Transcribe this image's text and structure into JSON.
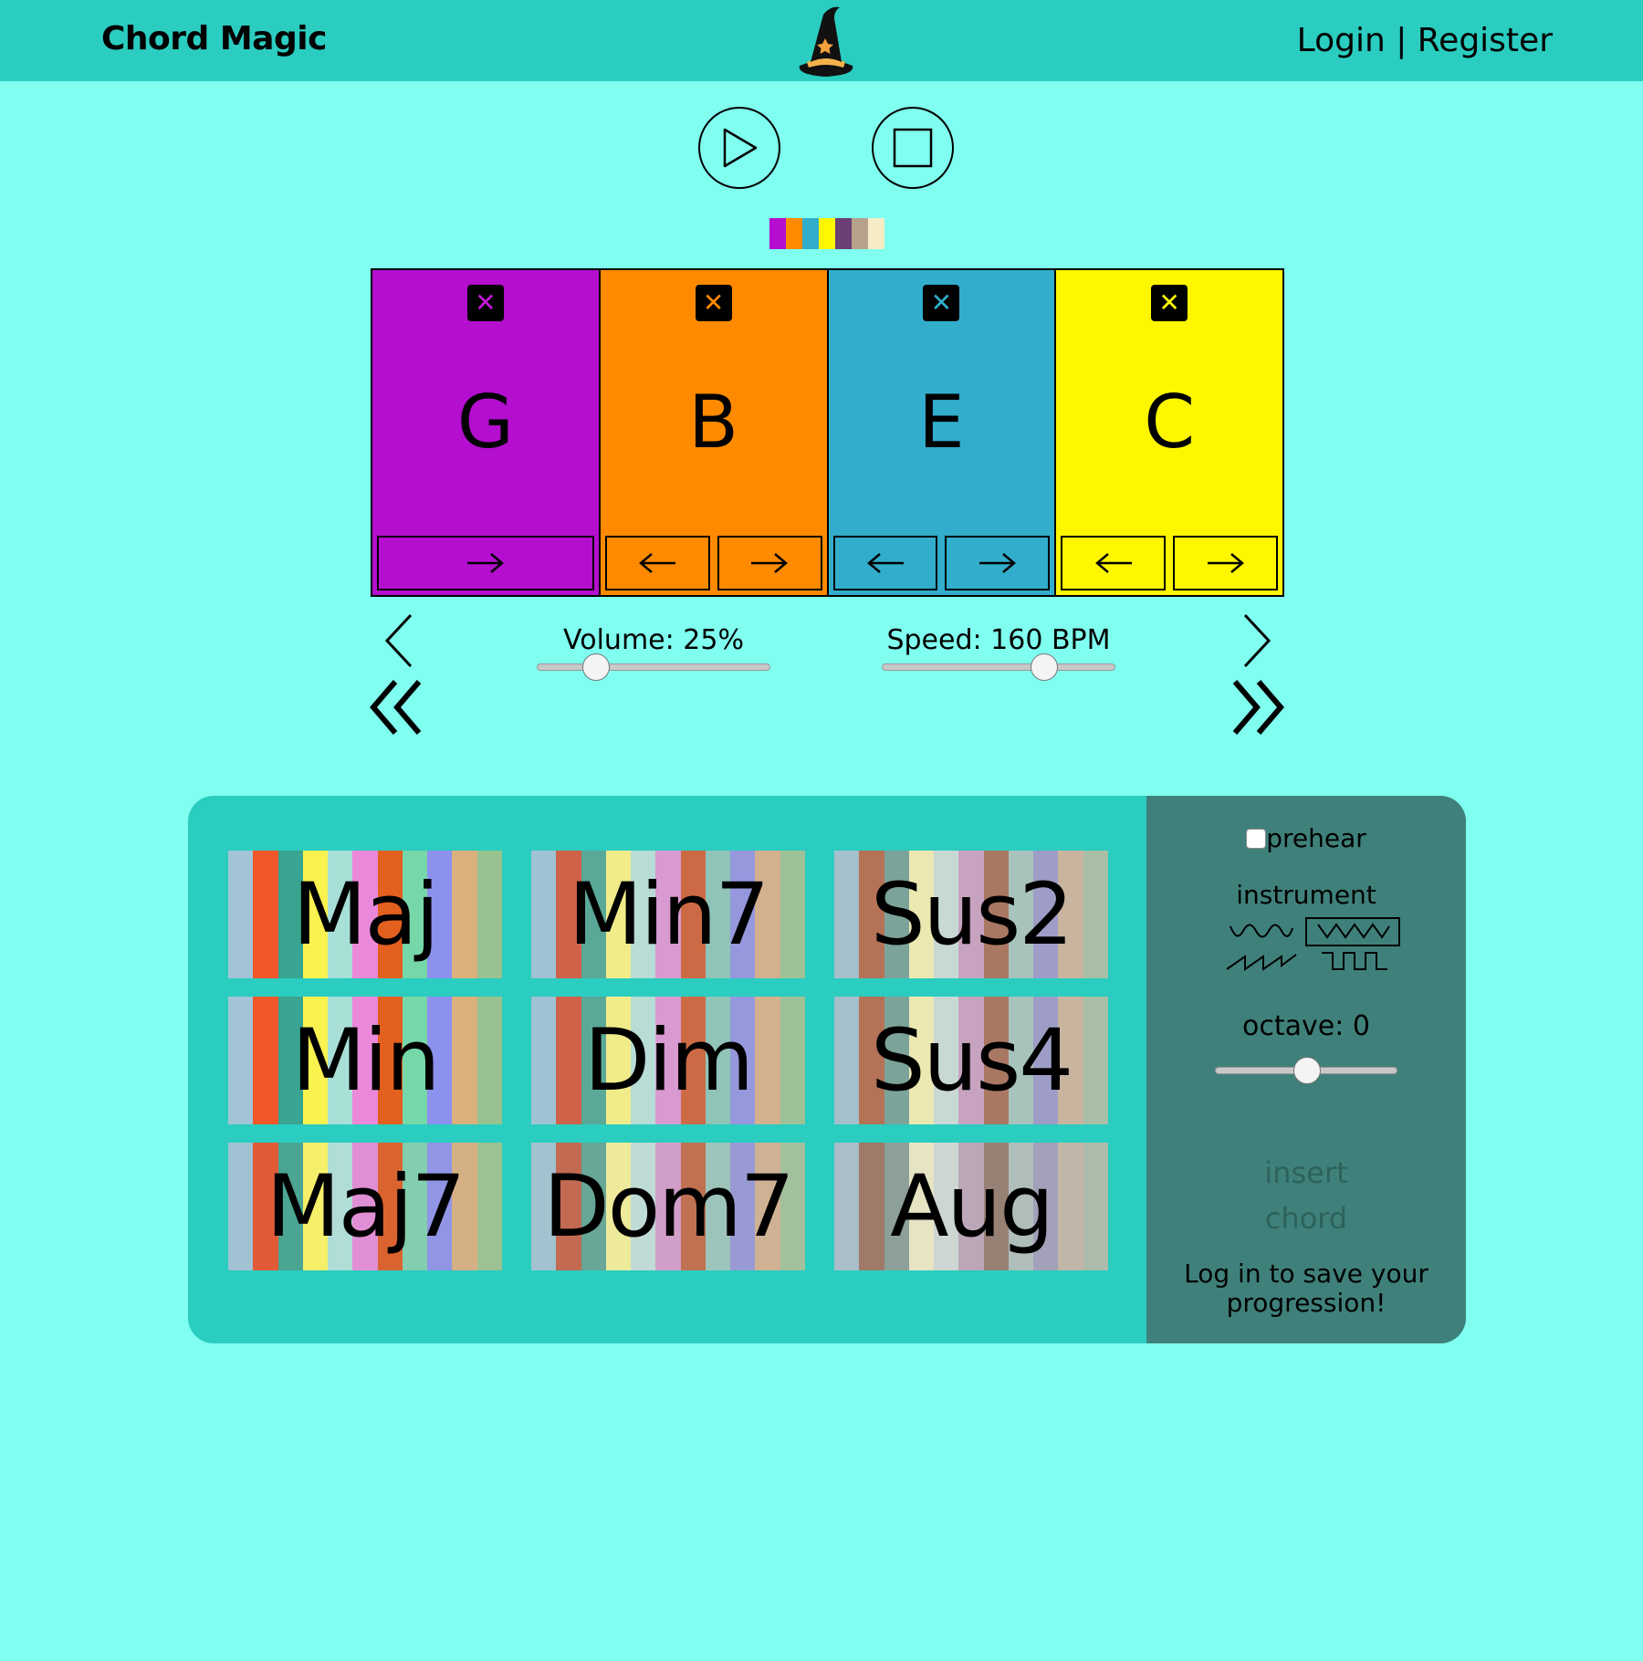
{
  "header": {
    "brand": "Chord Magic",
    "login": "Login",
    "separator": " | ",
    "register": "Register",
    "logo_icon": "wizard-hat-icon"
  },
  "transport": {
    "play_icon": "play-icon",
    "stop_icon": "stop-icon"
  },
  "color_strip": [
    "#b40ecf",
    "#ff8a00",
    "#32adcc",
    "#fff700",
    "#6b3e74",
    "#b6a18a",
    "#f5ecc6"
  ],
  "slots": [
    {
      "chord": "G",
      "color": "#b40ecf",
      "x_color": "#c31cd6",
      "moves": [
        "right"
      ]
    },
    {
      "chord": "B",
      "color": "#ff8a00",
      "x_color": "#ff8a00",
      "moves": [
        "left",
        "right"
      ]
    },
    {
      "chord": "E",
      "color": "#32adcc",
      "x_color": "#32adcc",
      "moves": [
        "left",
        "right"
      ]
    },
    {
      "chord": "C",
      "color": "#fff700",
      "x_color": "#fff700",
      "moves": [
        "left",
        "right"
      ]
    }
  ],
  "controls": {
    "volume_label": "Volume: 25%",
    "volume_value": 0.25,
    "speed_label": "Speed: 160 BPM",
    "speed_value": 0.69
  },
  "chord_types": [
    {
      "label": "Maj",
      "palette": [
        "#a3c4d6",
        "#f0572a",
        "#39a48f",
        "#faf24f",
        "#a8e0d8",
        "#ea88d9",
        "#e3601e",
        "#76d7a8",
        "#8c91ee",
        "#dab07c",
        "#98c290"
      ]
    },
    {
      "label": "Min7",
      "palette": [
        "#a0c3d4",
        "#d0624a",
        "#5aa897",
        "#f1ec8a",
        "#b8dcd6",
        "#d99ad1",
        "#cd6a46",
        "#90c4b8",
        "#9598dd",
        "#d3b08e",
        "#9fc197"
      ]
    },
    {
      "label": "Sus2",
      "palette": [
        "#a6bfcc",
        "#b47257",
        "#7ca39a",
        "#ece8b2",
        "#c8d9d4",
        "#c7a3bf",
        "#a97863",
        "#a8c3bc",
        "#9d9dc8",
        "#c9b49f",
        "#a8bfa6"
      ]
    },
    {
      "label": "Min",
      "palette": [
        "#a3c4d6",
        "#f0572a",
        "#39a48f",
        "#faf24f",
        "#a8e0d8",
        "#ea88d9",
        "#e3601e",
        "#76d7a8",
        "#8c91ee",
        "#dab07c",
        "#98c290"
      ]
    },
    {
      "label": "Dim",
      "palette": [
        "#a0c3d4",
        "#d0624a",
        "#5aa897",
        "#f1ec8a",
        "#b8dcd6",
        "#d99ad1",
        "#cd6a46",
        "#90c4b8",
        "#9598dd",
        "#d3b08e",
        "#9fc197"
      ]
    },
    {
      "label": "Sus4",
      "palette": [
        "#a6bfcc",
        "#b47257",
        "#7ca39a",
        "#ece8b2",
        "#c8d9d4",
        "#c7a3bf",
        "#a97863",
        "#a8c3bc",
        "#9d9dc8",
        "#c9b49f",
        "#a8bfa6"
      ]
    },
    {
      "label": "Maj7",
      "palette": [
        "#a0c2d2",
        "#e05b36",
        "#4aa592",
        "#f6ef6a",
        "#b0ded7",
        "#e18fd5",
        "#d96430",
        "#82ceae",
        "#9095e6",
        "#d6b085",
        "#9cc192"
      ]
    },
    {
      "label": "Dom7",
      "palette": [
        "#a3c2d0",
        "#c26a52",
        "#68a697",
        "#eeea9c",
        "#c0dbd5",
        "#d19ec9",
        "#bf7151",
        "#9cc4ba",
        "#999ad4",
        "#cfb294",
        "#a3c09c"
      ]
    },
    {
      "label": "Aug",
      "palette": [
        "#a9bec8",
        "#9f7a68",
        "#8d9f99",
        "#e7e4c4",
        "#cdd6d3",
        "#bba7b7",
        "#978074",
        "#afbeba",
        "#a3a1b9",
        "#c2b6a8",
        "#adbcaa"
      ]
    }
  ],
  "side": {
    "prehear": "prehear",
    "prehear_checked": false,
    "instrument": "instrument",
    "instruments": [
      "sine-wave-icon",
      "triangle-wave-icon",
      "sawtooth-wave-icon",
      "square-wave-icon"
    ],
    "selected_instrument": "triangle-wave-icon",
    "octave_label": "octave: 0",
    "octave_value": 0.5,
    "insert_line1": "insert",
    "insert_line2": "chord",
    "save_message": "Log in to save your progression!"
  }
}
